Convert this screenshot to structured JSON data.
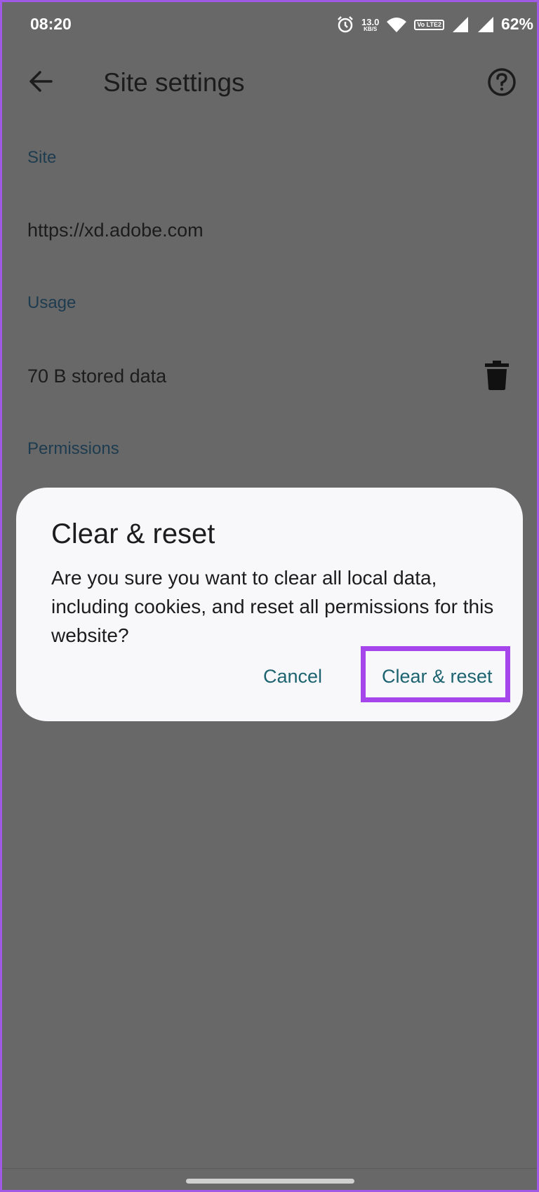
{
  "status_bar": {
    "time": "08:20",
    "net_speed_value": "13.0",
    "net_speed_unit": "KB/S",
    "lte_label": "Vo LTE2",
    "battery": "62%"
  },
  "app_bar": {
    "title": "Site settings",
    "back_icon": "arrow-back-icon",
    "help_icon": "help-circle-icon"
  },
  "sections": {
    "site_label": "Site",
    "site_url": "https://xd.adobe.com",
    "usage_label": "Usage",
    "usage_value": "70 B stored data",
    "permissions_label": "Permissions"
  },
  "dialog": {
    "title": "Clear & reset",
    "body": "Are you sure you want to clear all local data, including cookies, and reset all permissions for this website?",
    "cancel_label": "Cancel",
    "confirm_label": "Clear & reset"
  },
  "colors": {
    "accent_text": "#1d6470",
    "highlight": "#a545ec",
    "scrim_background": "#686868"
  }
}
